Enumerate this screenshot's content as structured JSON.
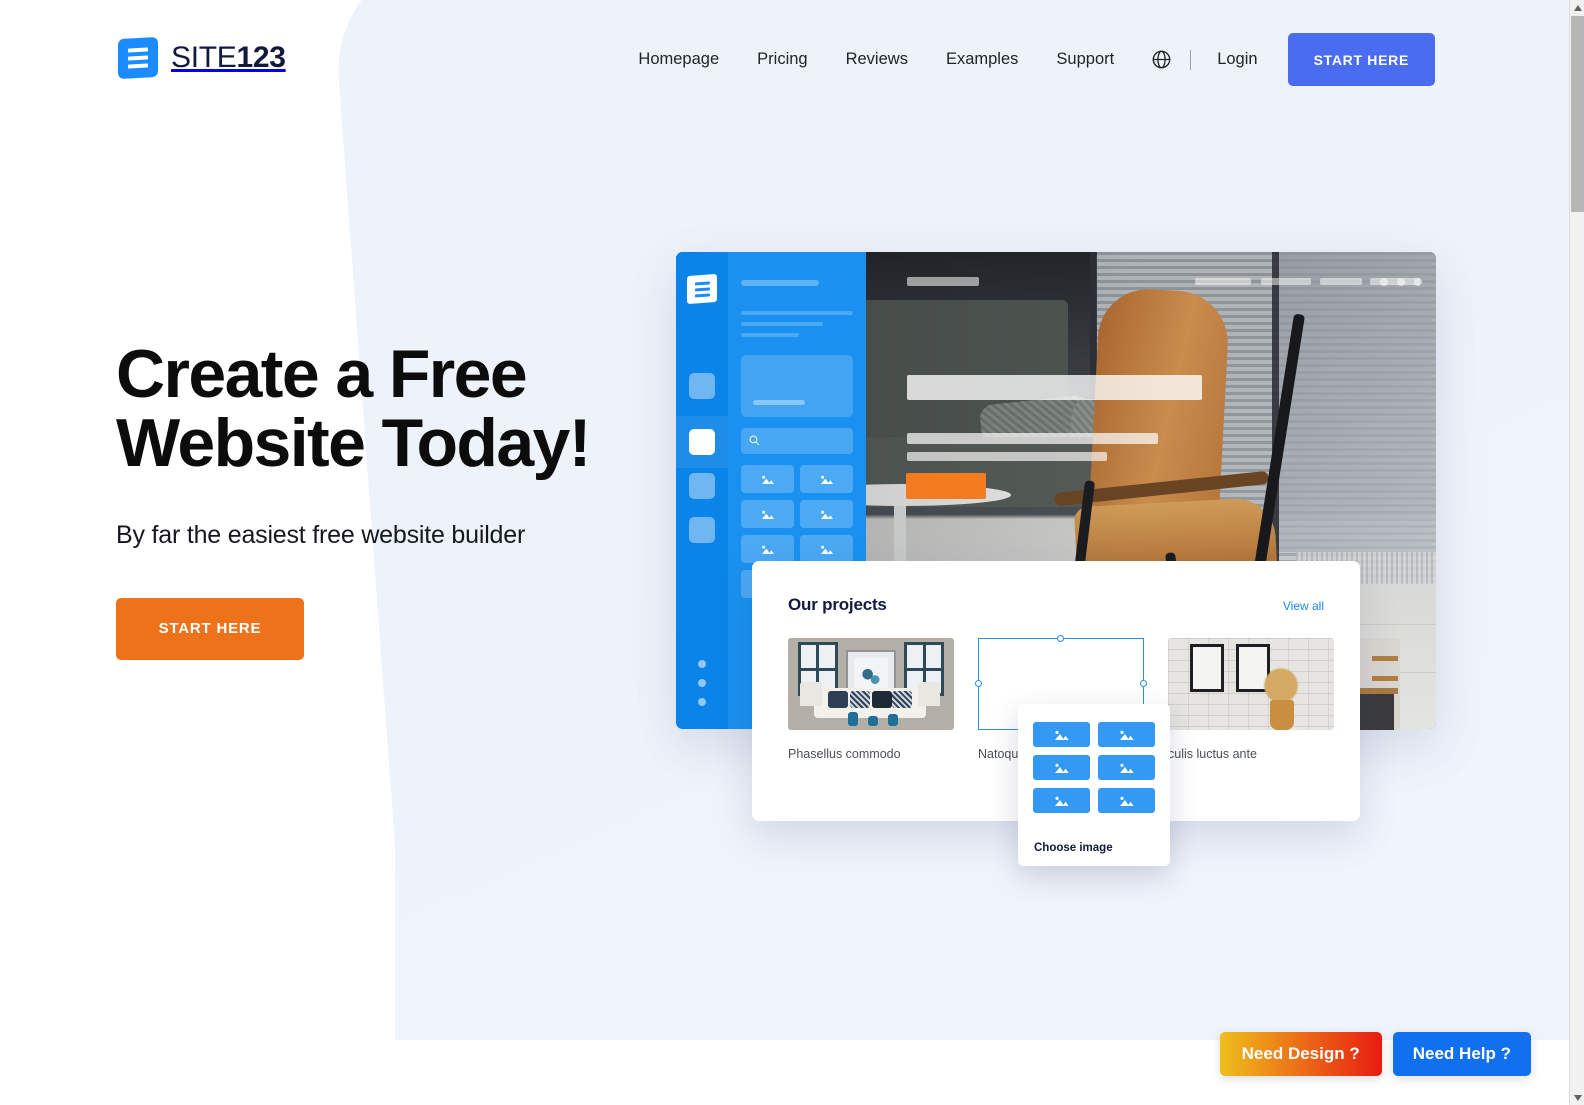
{
  "brand": {
    "name_regular": "SITE",
    "name_bold": "123",
    "logo_icon": "site123-logo-icon",
    "accent_blue": "#4a6cf0",
    "accent_orange": "#ee7219",
    "mark_blue": "#1a8cff"
  },
  "nav": {
    "items": [
      {
        "label": "Homepage"
      },
      {
        "label": "Pricing"
      },
      {
        "label": "Reviews"
      },
      {
        "label": "Examples"
      },
      {
        "label": "Support"
      }
    ],
    "globe_icon": "globe-icon",
    "divider": "|",
    "login_label": "Login",
    "cta_label": "START HERE"
  },
  "hero": {
    "title_line1": "Create a Free",
    "title_line2": "Website Today!",
    "subtitle": "By far the easiest free website builder",
    "cta_label": "START HERE"
  },
  "mockup": {
    "sidebar": {
      "logo_icon": "editor-logo-icon",
      "items": [
        {
          "name": "editor-nav-item-1",
          "active": false
        },
        {
          "name": "editor-nav-item-2",
          "active": true
        },
        {
          "name": "editor-nav-item-3",
          "active": false
        },
        {
          "name": "editor-nav-item-4",
          "active": false
        }
      ],
      "more_icon": "more-dots-icon"
    },
    "panel": {
      "search_icon": "search-icon",
      "image_tile_icon": "image-placeholder-icon",
      "tile_count": 8
    },
    "topbar": {
      "logo_placeholder": "site-logo-placeholder",
      "nav_placeholders": 4,
      "menu_dots_icon": "three-dots-icon"
    },
    "hero_cta_placeholder": "orange-cta-placeholder"
  },
  "projects_card": {
    "title": "Our projects",
    "view_all_label": "View all",
    "items": [
      {
        "caption": "Phasellus commodo",
        "state": "image"
      },
      {
        "caption": "Natoque",
        "state": "selected-empty"
      },
      {
        "caption": "culis luctus ante",
        "state": "image"
      }
    ]
  },
  "choose_image_popup": {
    "label": "Choose image",
    "tile_icon": "image-placeholder-icon",
    "tile_count": 6
  },
  "floating_buttons": {
    "design_label": "Need Design ?",
    "help_label": "Need Help ?",
    "design_gradient_from": "#efbf1c",
    "design_gradient_to": "#e81c10",
    "help_color": "#1170ee"
  },
  "scrollbar": {
    "up_arrow_icon": "scroll-up-arrow-icon",
    "down_arrow_icon": "scroll-down-arrow-icon",
    "thumb": "scroll-thumb"
  }
}
